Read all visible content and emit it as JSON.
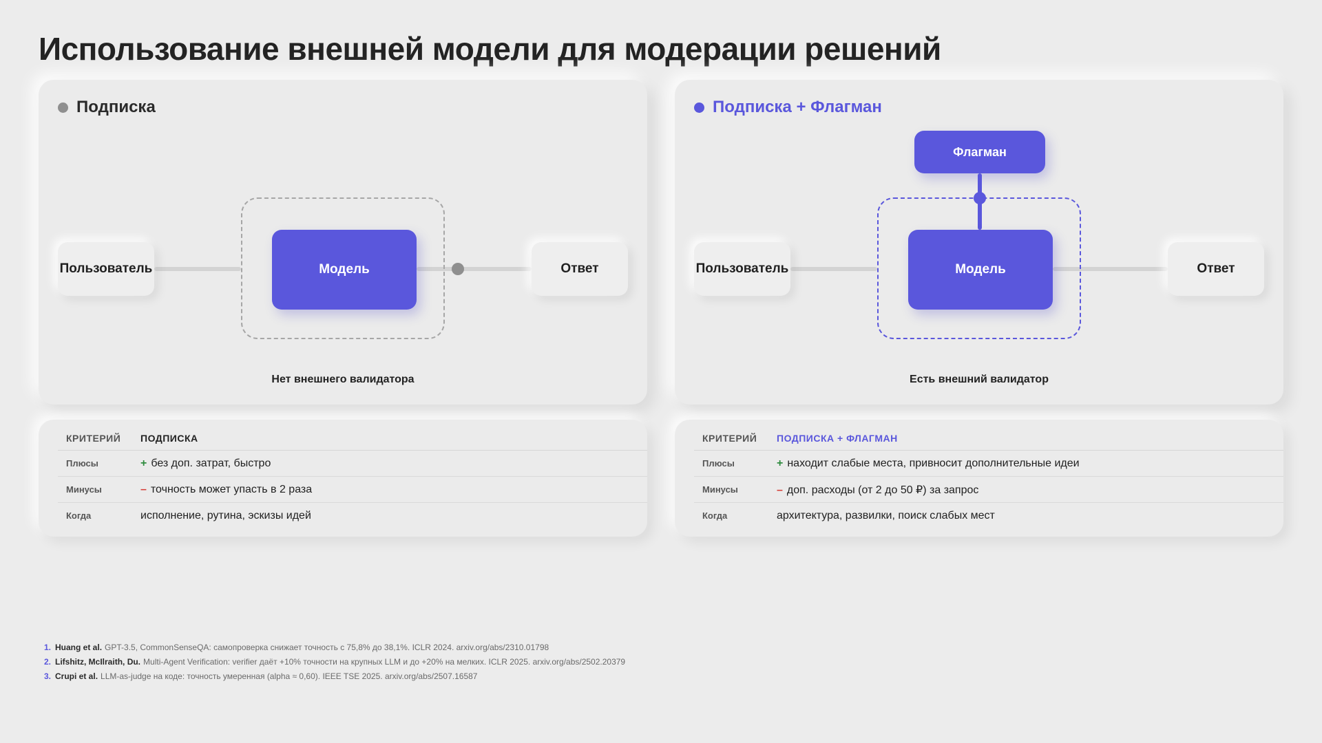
{
  "title": "Использование внешней модели для модерации решений",
  "colors": {
    "accent": "#5a57dc",
    "neutral_dot": "#8f8f8f",
    "plus": "#2e8b3e",
    "minus": "#d6403a"
  },
  "left_panel": {
    "title": "Подписка",
    "nodes": {
      "user": "Пользователь",
      "model": "Модель",
      "answer": "Ответ"
    },
    "caption": "Нет внешнего валидатора"
  },
  "right_panel": {
    "title": "Подписка + Флагман",
    "nodes": {
      "user": "Пользователь",
      "model": "Модель",
      "answer": "Ответ",
      "flagship": "Флагман"
    },
    "caption": "Есть внешний валидатор"
  },
  "left_table": {
    "headers": [
      "КРИТЕРИЙ",
      "ПОДПИСКА"
    ],
    "rows": [
      {
        "criterion": "Плюсы",
        "sign": "+",
        "value": "без доп. затрат, быстро"
      },
      {
        "criterion": "Минусы",
        "sign": "–",
        "value": "точность может упасть в 2 раза"
      },
      {
        "criterion": "Когда",
        "sign": "",
        "value": "исполнение, рутина, эскизы идей"
      }
    ]
  },
  "right_table": {
    "headers": [
      "КРИТЕРИЙ",
      "ПОДПИСКА + ФЛАГМАН"
    ],
    "rows": [
      {
        "criterion": "Плюсы",
        "sign": "+",
        "value": "находит слабые места, привносит дополнительные идеи"
      },
      {
        "criterion": "Минусы",
        "sign": "–",
        "value": "доп. расходы (от 2 до 50 ₽) за запрос"
      },
      {
        "criterion": "Когда",
        "sign": "",
        "value": "архитектура, развилки, поиск слабых мест"
      }
    ]
  },
  "footnotes": [
    {
      "num": "1.",
      "author": "Huang et al.",
      "text": "GPT-3.5, CommonSenseQA: самопроверка снижает точность с 75,8% до 38,1%. ICLR 2024. arxiv.org/abs/2310.01798"
    },
    {
      "num": "2.",
      "author": "Lifshitz, McIlraith, Du.",
      "text": "Multi-Agent Verification: verifier даёт +10% точности на крупных LLM и до +20% на мелких. ICLR 2025. arxiv.org/abs/2502.20379"
    },
    {
      "num": "3.",
      "author": "Crupi et al.",
      "text": "LLM-as-judge на коде: точность умеренная (alpha ≈ 0,60). IEEE TSE 2025. arxiv.org/abs/2507.16587"
    }
  ]
}
